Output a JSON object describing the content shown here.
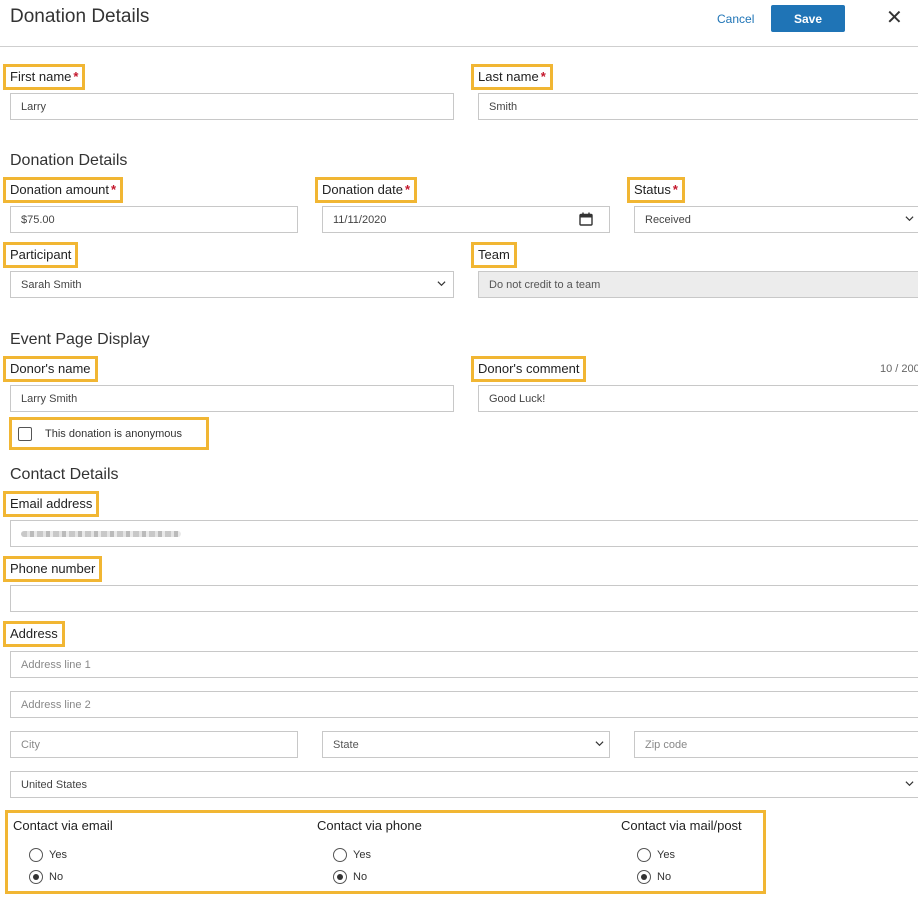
{
  "header": {
    "title": "Donation Details",
    "cancel_label": "Cancel",
    "save_label": "Save",
    "close_glyph": "✕"
  },
  "name": {
    "first_label": "First name",
    "first_value": "Larry",
    "last_label": "Last name",
    "last_value": "Smith",
    "required_mark": "*"
  },
  "donation": {
    "section_title": "Donation Details",
    "amount_label": "Donation amount",
    "amount_value": "$75.00",
    "date_label": "Donation date",
    "date_value": "11/11/2020",
    "status_label": "Status",
    "status_value": "Received",
    "participant_label": "Participant",
    "participant_value": "Sarah Smith",
    "team_label": "Team",
    "team_value": "Do not credit to a team"
  },
  "event_display": {
    "section_title": "Event Page Display",
    "donor_name_label": "Donor's name",
    "donor_name_value": "Larry Smith",
    "donor_comment_label": "Donor's comment",
    "donor_comment_value": "Good Luck!",
    "comment_counter": "10 / 200",
    "anonymous_label": "This donation is anonymous",
    "anonymous_checked": false
  },
  "contact": {
    "section_title": "Contact Details",
    "email_label": "Email address",
    "phone_label": "Phone number",
    "phone_value": "",
    "address_label": "Address",
    "address1_placeholder": "Address line 1",
    "address2_placeholder": "Address line 2",
    "city_placeholder": "City",
    "state_placeholder": "State",
    "zip_placeholder": "Zip code",
    "country_value": "United States"
  },
  "preferences": {
    "email_title": "Contact via email",
    "phone_title": "Contact via phone",
    "mail_title": "Contact via mail/post",
    "yes_label": "Yes",
    "no_label": "No",
    "email_selected": "No",
    "phone_selected": "No",
    "mail_selected": "No"
  },
  "colors": {
    "accent": "#1f74b6",
    "highlight": "#f1b633",
    "required": "#c4172c"
  },
  "icons": [
    "close-icon",
    "calendar-icon",
    "chevron-down-icon"
  ]
}
